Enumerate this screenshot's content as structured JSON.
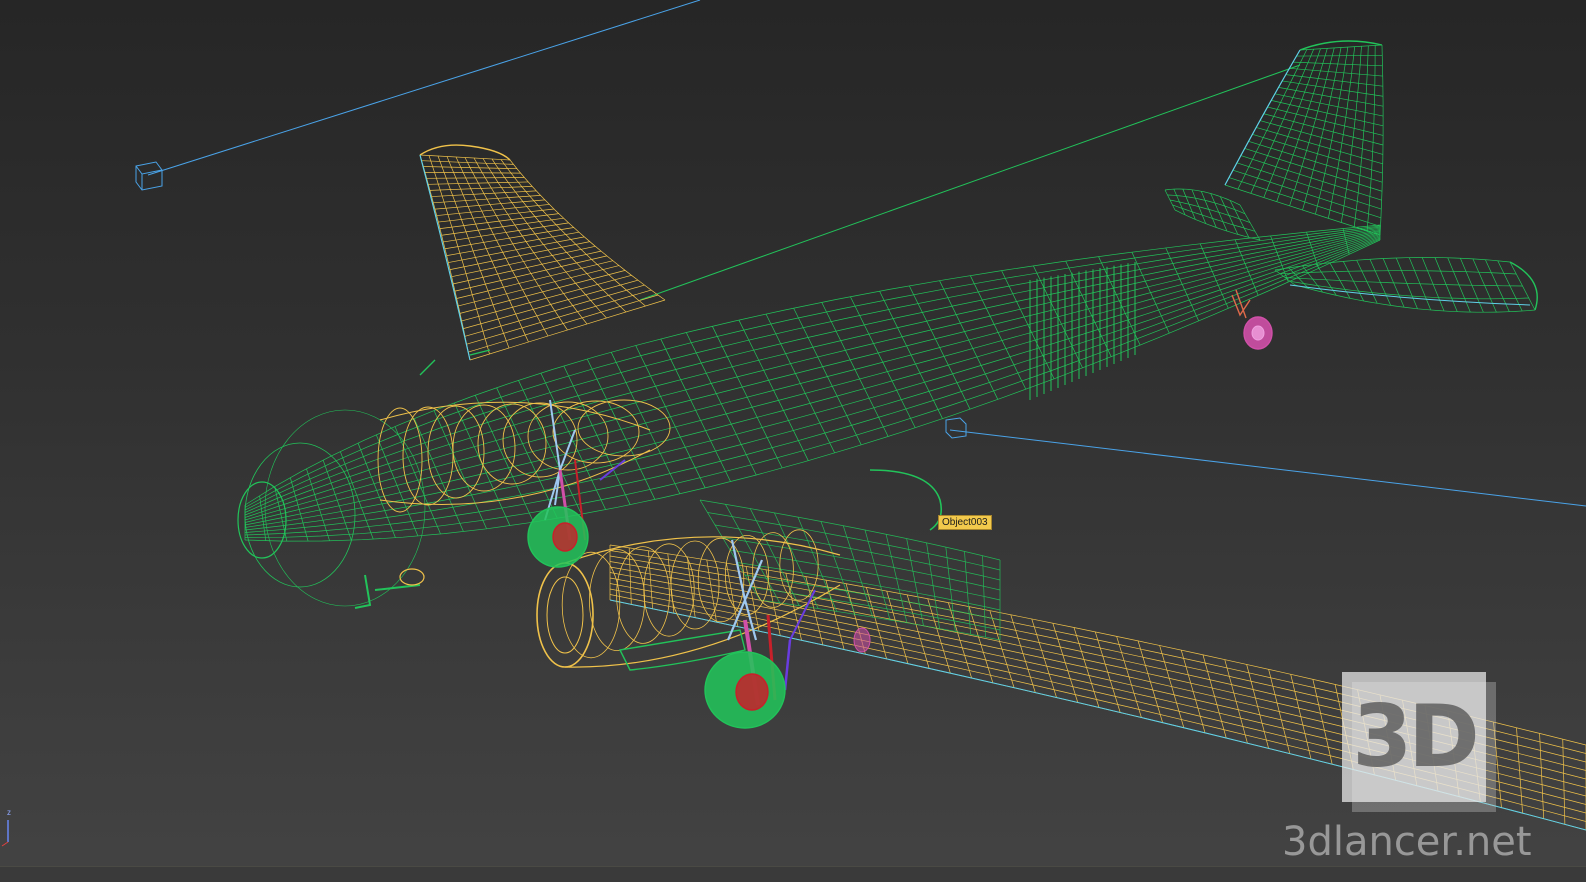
{
  "viewport": {
    "tooltip_label": "Object003",
    "axis_label": "z"
  },
  "watermark": {
    "badge_text": "3D",
    "site_text": "3dlancer.net"
  },
  "colors": {
    "background": "#2a2a2a",
    "wire_green": "#22c35a",
    "wire_yellow": "#f0c24a",
    "wire_cyan": "#5fd0e8",
    "wire_blue": "#4aa3e8",
    "wire_magenta": "#d050a8",
    "wire_red": "#c8202a",
    "wire_violet": "#6a3ce0",
    "wire_light_blue": "#9fc8f0",
    "tooltip_bg": "#f2c94c"
  }
}
